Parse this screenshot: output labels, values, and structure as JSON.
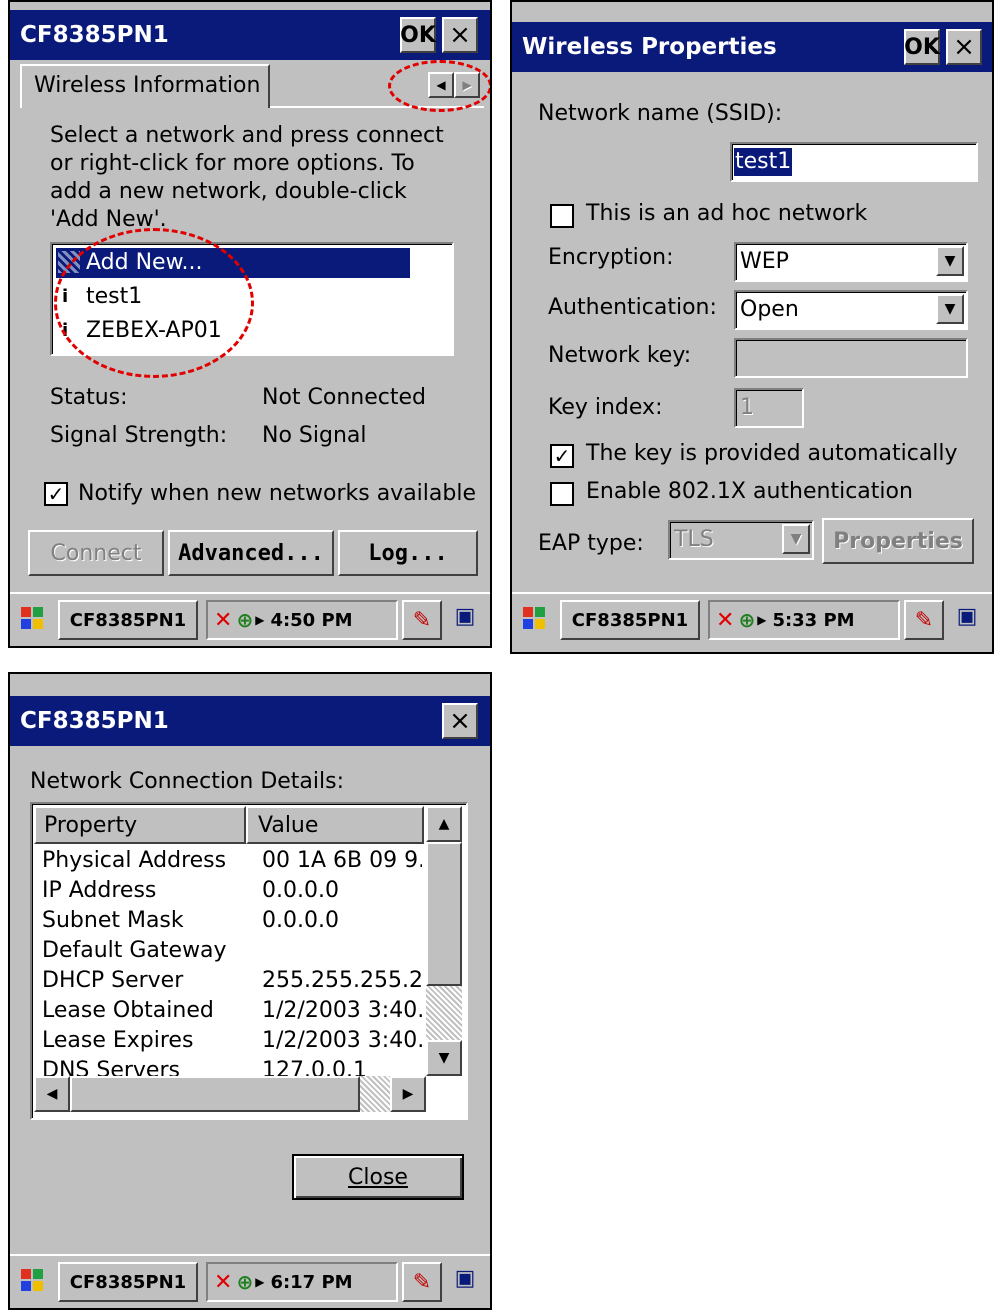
{
  "panel1": {
    "title": "CF8385PN1",
    "ok": "OK",
    "close": "×",
    "tab": "Wireless Information",
    "instructions": [
      "Select a network and press connect",
      "or right-click for more options.  To",
      "add a new network, double-click",
      "'Add New'."
    ],
    "networks": [
      "Add New...",
      "test1",
      "ZEBEX-AP01"
    ],
    "status_label": "Status:",
    "status_value": "Not Connected",
    "signal_label": "Signal Strength:",
    "signal_value": "No Signal",
    "notify_label": "Notify when new networks available",
    "notify_checked": "✓",
    "btn_connect": "Connect",
    "btn_advanced": "Advanced...",
    "btn_log": "Log...",
    "taskbar_app": "CF8385PN1",
    "time": "4:50 PM"
  },
  "panel2": {
    "title": "Wireless Properties",
    "ok": "OK",
    "close": "×",
    "ssid_label": "Network name (SSID):",
    "ssid_value": "test1",
    "adhoc_label": "This is an ad hoc network",
    "encryption_label": "Encryption:",
    "encryption_value": "WEP",
    "auth_label": "Authentication:",
    "auth_value": "Open",
    "key_label": "Network key:",
    "key_index_label": "Key index:",
    "key_index_value": "1",
    "key_auto_label": "The key is provided automatically",
    "key_auto_checked": "✓",
    "dot1x_label": "Enable 802.1X authentication",
    "eap_label": "EAP type:",
    "eap_value": "TLS",
    "btn_properties": "Properties",
    "taskbar_app": "CF8385PN1",
    "time": "5:33 PM"
  },
  "panel3": {
    "title": "CF8385PN1",
    "close": "×",
    "details_label": "Network Connection Details:",
    "col_property": "Property",
    "col_value": "Value",
    "rows": [
      {
        "property": "Physical Address",
        "value": "00 1A 6B 09 9."
      },
      {
        "property": "IP Address",
        "value": "0.0.0.0"
      },
      {
        "property": "Subnet Mask",
        "value": "0.0.0.0"
      },
      {
        "property": "Default Gateway",
        "value": ""
      },
      {
        "property": "DHCP Server",
        "value": "255.255.255.2!"
      },
      {
        "property": "Lease Obtained",
        "value": "1/2/2003 3:40."
      },
      {
        "property": "Lease Expires",
        "value": "1/2/2003 3:40."
      },
      {
        "property": "DNS Servers",
        "value": "127.0.0.1"
      }
    ],
    "btn_close": "Close",
    "taskbar_app": "CF8385PN1",
    "time": "6:17 PM"
  },
  "colors": {
    "titlebar": "#0a1a7a",
    "selection": "#0a1a7a",
    "highlight_circle": "#e00000",
    "dialog_bg": "#c0c0c0"
  },
  "icons": [
    "windows-start-icon",
    "network-disconnected-icon",
    "wireless-tray-icon",
    "tray-arrow-icon",
    "input-panel-icon",
    "desktop-switch-icon"
  ]
}
